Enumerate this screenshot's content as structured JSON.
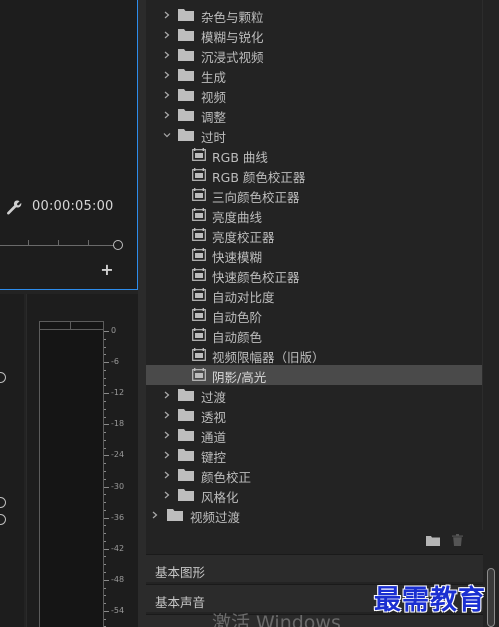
{
  "monitor": {
    "timecode": "00:00:05:00"
  },
  "meter": {
    "labels": [
      "0",
      "-6",
      "-12",
      "-18",
      "-24",
      "-30",
      "-36",
      "-42",
      "-48",
      "-54"
    ]
  },
  "effects_tree": {
    "items": [
      {
        "label": "杂色与颗粒",
        "type": "folder",
        "expanded": false
      },
      {
        "label": "模糊与锐化",
        "type": "folder",
        "expanded": false
      },
      {
        "label": "沉浸式视频",
        "type": "folder",
        "expanded": false
      },
      {
        "label": "生成",
        "type": "folder",
        "expanded": false
      },
      {
        "label": "视频",
        "type": "folder",
        "expanded": false
      },
      {
        "label": "调整",
        "type": "folder",
        "expanded": false
      },
      {
        "label": "过时",
        "type": "folder",
        "expanded": true
      },
      {
        "label": "RGB 曲线",
        "type": "effect"
      },
      {
        "label": "RGB 颜色校正器",
        "type": "effect"
      },
      {
        "label": "三向颜色校正器",
        "type": "effect"
      },
      {
        "label": "亮度曲线",
        "type": "effect"
      },
      {
        "label": "亮度校正器",
        "type": "effect"
      },
      {
        "label": "快速模糊",
        "type": "effect"
      },
      {
        "label": "快速颜色校正器",
        "type": "effect"
      },
      {
        "label": "自动对比度",
        "type": "effect"
      },
      {
        "label": "自动色阶",
        "type": "effect"
      },
      {
        "label": "自动颜色",
        "type": "effect"
      },
      {
        "label": "视频限幅器（旧版）",
        "type": "effect"
      },
      {
        "label": "阴影/高光",
        "type": "effect",
        "selected": true
      },
      {
        "label": "过渡",
        "type": "folder",
        "expanded": false
      },
      {
        "label": "透视",
        "type": "folder",
        "expanded": false
      },
      {
        "label": "通道",
        "type": "folder",
        "expanded": false
      },
      {
        "label": "键控",
        "type": "folder",
        "expanded": false
      },
      {
        "label": "颜色校正",
        "type": "folder",
        "expanded": false
      },
      {
        "label": "风格化",
        "type": "folder",
        "expanded": false
      }
    ],
    "top_level": {
      "label": "视频过渡",
      "type": "folder",
      "expanded": false
    }
  },
  "sections": {
    "basic_graphics": "基本图形",
    "basic_audio": "基本声音"
  },
  "overlay": {
    "activate_windows": "激活 Windows",
    "watermark": "最需教育"
  },
  "colors": {
    "selection_border": "#2d8ceb",
    "selected_row": "#4a4a4a",
    "watermark": "#1a2fd1"
  }
}
